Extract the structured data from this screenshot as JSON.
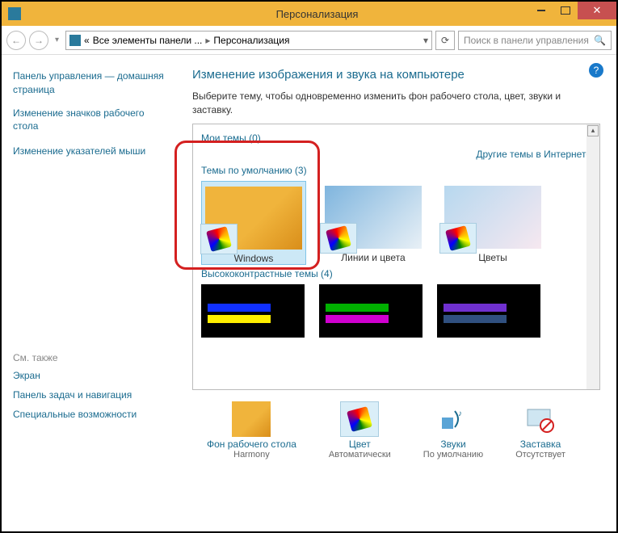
{
  "titlebar": {
    "title": "Персонализация"
  },
  "nav": {
    "breadcrumb_prefix": "«",
    "breadcrumb1": "Все элементы панели ...",
    "breadcrumb2": "Персонализация",
    "search_placeholder": "Поиск в панели управления"
  },
  "sidebar": {
    "home": "Панель управления — домашняя страница",
    "link1": "Изменение значков рабочего стола",
    "link2": "Изменение указателей мыши",
    "also_head": "См. также",
    "also1": "Экран",
    "also2": "Панель задач и навигация",
    "also3": "Специальные возможности"
  },
  "main": {
    "title": "Изменение изображения и звука на компьютере",
    "sub": "Выберите тему, чтобы одновременно изменить фон рабочего стола, цвет, звуки и заставку.",
    "my_themes": "Мои темы (0)",
    "online": "Другие темы в Интернете",
    "default_themes": "Темы по умолчанию (3)",
    "t1": "Windows",
    "t2": "Линии и цвета",
    "t3": "Цветы",
    "hc_label": "Высококонтрастные темы (4)"
  },
  "bottom": {
    "wall_t": "Фон рабочего стола",
    "wall_s": "Harmony",
    "color_t": "Цвет",
    "color_s": "Автоматически",
    "sound_t": "Звуки",
    "sound_s": "По умолчанию",
    "ss_t": "Заставка",
    "ss_s": "Отсутствует"
  }
}
